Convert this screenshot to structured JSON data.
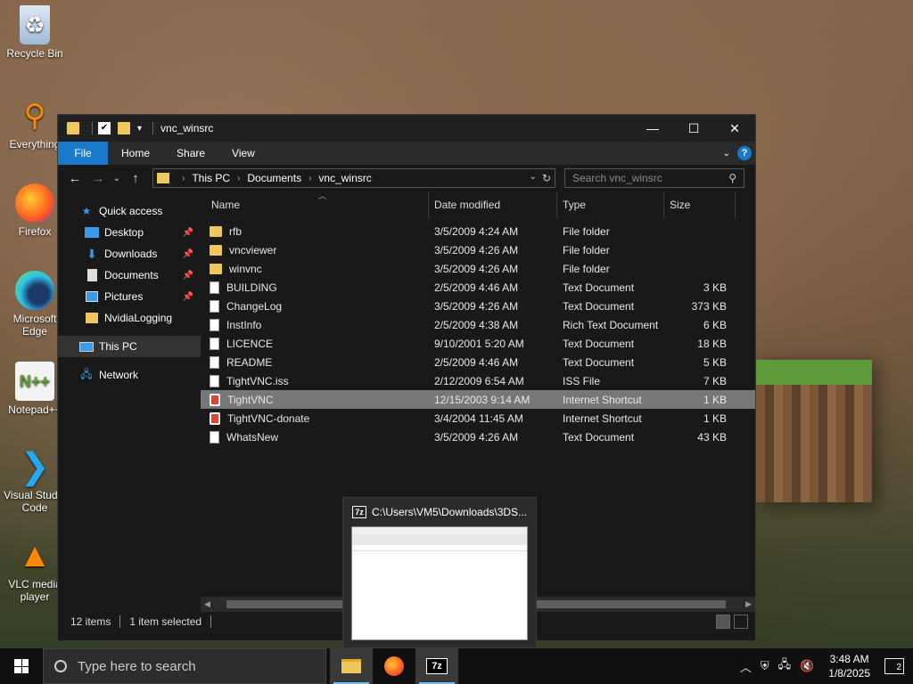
{
  "desktop": {
    "icons": [
      {
        "label": "Recycle Bin"
      },
      {
        "label": "Everything"
      },
      {
        "label": "Firefox"
      },
      {
        "label": "Microsoft Edge"
      },
      {
        "label": "Notepad++"
      },
      {
        "label": "Visual Studio Code"
      },
      {
        "label": "VLC media player"
      }
    ]
  },
  "window": {
    "title": "vnc_winsrc",
    "ribbon_tabs": [
      "File",
      "Home",
      "Share",
      "View"
    ],
    "address": {
      "crumbs": [
        "This PC",
        "Documents",
        "vnc_winsrc"
      ]
    },
    "search": {
      "placeholder": "Search vnc_winsrc"
    },
    "nav": {
      "quick_access": "Quick access",
      "items": [
        {
          "label": "Desktop",
          "pinned": true
        },
        {
          "label": "Downloads",
          "pinned": true
        },
        {
          "label": "Documents",
          "pinned": true
        },
        {
          "label": "Pictures",
          "pinned": true
        },
        {
          "label": "NvidiaLogging",
          "pinned": false
        }
      ],
      "this_pc": "This PC",
      "network": "Network"
    },
    "columns": {
      "name": "Name",
      "date": "Date modified",
      "type": "Type",
      "size": "Size"
    },
    "files": [
      {
        "name": "rfb",
        "date": "3/5/2009 4:24 AM",
        "type": "File folder",
        "size": "",
        "icon": "folder-icon"
      },
      {
        "name": "vncviewer",
        "date": "3/5/2009 4:26 AM",
        "type": "File folder",
        "size": "",
        "icon": "folder-icon"
      },
      {
        "name": "winvnc",
        "date": "3/5/2009 4:26 AM",
        "type": "File folder",
        "size": "",
        "icon": "folder-icon"
      },
      {
        "name": "BUILDING",
        "date": "2/5/2009 4:46 AM",
        "type": "Text Document",
        "size": "3 KB",
        "icon": "text-document-icon"
      },
      {
        "name": "ChangeLog",
        "date": "3/5/2009 4:26 AM",
        "type": "Text Document",
        "size": "373 KB",
        "icon": "text-document-icon"
      },
      {
        "name": "InstInfo",
        "date": "2/5/2009 4:38 AM",
        "type": "Rich Text Document",
        "size": "6 KB",
        "icon": "text-document-icon"
      },
      {
        "name": "LICENCE",
        "date": "9/10/2001 5:20 AM",
        "type": "Text Document",
        "size": "18 KB",
        "icon": "text-document-icon"
      },
      {
        "name": "README",
        "date": "2/5/2009 4:46 AM",
        "type": "Text Document",
        "size": "5 KB",
        "icon": "text-document-icon"
      },
      {
        "name": "TightVNC.iss",
        "date": "2/12/2009 6:54 AM",
        "type": "ISS File",
        "size": "7 KB",
        "icon": "text-document-icon"
      },
      {
        "name": "TightVNC",
        "date": "12/15/2003 9:14 AM",
        "type": "Internet Shortcut",
        "size": "1 KB",
        "icon": "internet-shortcut-icon",
        "selected": true
      },
      {
        "name": "TightVNC-donate",
        "date": "3/4/2004 11:45 AM",
        "type": "Internet Shortcut",
        "size": "1 KB",
        "icon": "internet-shortcut-icon"
      },
      {
        "name": "WhatsNew",
        "date": "3/5/2009 4:26 AM",
        "type": "Text Document",
        "size": "43 KB",
        "icon": "text-document-icon"
      }
    ],
    "status": {
      "count": "12 items",
      "selected": "1 item selected"
    }
  },
  "preview": {
    "title": "C:\\Users\\VM5\\Downloads\\3DS...",
    "app_badge": "7z"
  },
  "taskbar": {
    "search_placeholder": "Type here to search",
    "apps": [
      "File Explorer",
      "Firefox",
      "7-Zip"
    ],
    "z7_label": "7z",
    "clock_time": "3:48 AM",
    "clock_date": "1/8/2025",
    "notifications": "2"
  },
  "colors": {
    "accent": "#1979ca",
    "folder": "#f0c75e",
    "selected_row": "#777777"
  }
}
